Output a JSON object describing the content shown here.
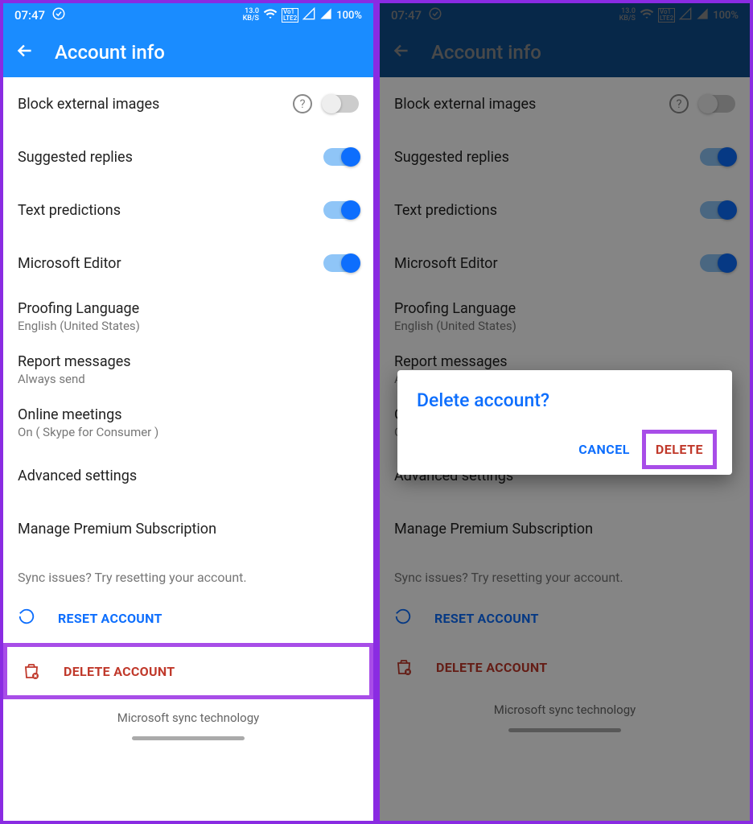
{
  "status": {
    "time": "07:47",
    "kbs_top": "13.0",
    "kbs_bot": "KB/S",
    "battery": "100%"
  },
  "appbar": {
    "title": "Account info"
  },
  "rows": {
    "block_images": "Block external images",
    "suggested": "Suggested replies",
    "text_pred": "Text predictions",
    "editor": "Microsoft Editor",
    "proofing": "Proofing Language",
    "proofing_sub": "English (United States)",
    "report": "Report messages",
    "report_sub": "Always send",
    "meetings": "Online meetings",
    "meetings_sub": "On ( Skype for Consumer )",
    "advanced": "Advanced settings",
    "premium": "Manage Premium Subscription"
  },
  "sync_hint": "Sync issues? Try resetting your account.",
  "actions": {
    "reset": "RESET ACCOUNT",
    "delete": "DELETE ACCOUNT"
  },
  "footer": "Microsoft sync technology",
  "dialog": {
    "title": "Delete account?",
    "cancel": "CANCEL",
    "delete": "DELETE"
  }
}
